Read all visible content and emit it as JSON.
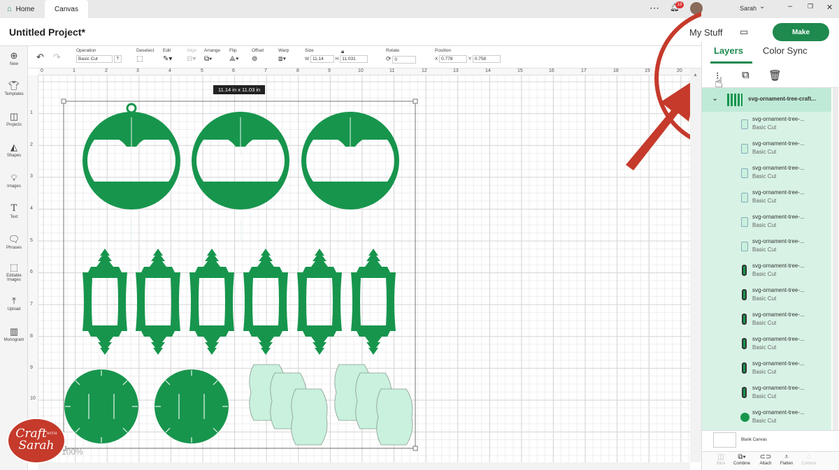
{
  "tabs": {
    "home": "Home",
    "canvas": "Canvas"
  },
  "window": {
    "notifications": "13",
    "user": "Sarah",
    "my_stuff": "My Stuff"
  },
  "header": {
    "project_title": "Untitled Project*",
    "make": "Make"
  },
  "left_nav": [
    "New",
    "Templates",
    "Projects",
    "Shapes",
    "Images",
    "Text",
    "Phrases",
    "Editable Images",
    "Upload",
    "Monogram"
  ],
  "toolbar": {
    "operation_label": "Operation",
    "operation_value": "Basic Cut",
    "deselect": "Deselect",
    "edit": "Edit",
    "align": "Align",
    "arrange": "Arrange",
    "flip": "Flip",
    "offset": "Offset",
    "warp": "Warp",
    "size_label": "Size",
    "w_label": "W",
    "w_value": "11.14",
    "h_label": "H",
    "h_value": "11.031",
    "rotate_label": "Rotate",
    "rotate_value": "0",
    "position_label": "Position",
    "x_label": "X",
    "x_value": "0.778",
    "y_label": "Y",
    "y_value": "0.758"
  },
  "rulers": {
    "top": [
      "0",
      "1",
      "2",
      "3",
      "4",
      "5",
      "6",
      "7",
      "8",
      "9",
      "10",
      "11",
      "12",
      "13",
      "14",
      "15",
      "16",
      "17",
      "18",
      "19",
      "20"
    ],
    "left": [
      "1",
      "2",
      "3",
      "4",
      "5",
      "6",
      "7",
      "8",
      "9",
      "10"
    ]
  },
  "canvas": {
    "size_tooltip": "11.14  in x 11.03  in",
    "zoom": "100%"
  },
  "panel": {
    "tab_layers": "Layers",
    "tab_color": "Color Sync",
    "group_name": "svg-ornament-tree-craft...",
    "layers": [
      {
        "name": "svg-ornament-tree-...",
        "op": "Basic Cut",
        "color": "#c9f1dd",
        "shape": "rect"
      },
      {
        "name": "svg-ornament-tree-...",
        "op": "Basic Cut",
        "color": "#c9f1dd",
        "shape": "rect"
      },
      {
        "name": "svg-ornament-tree-...",
        "op": "Basic Cut",
        "color": "#c9f1dd",
        "shape": "rect"
      },
      {
        "name": "svg-ornament-tree-...",
        "op": "Basic Cut",
        "color": "#c9f1dd",
        "shape": "rect"
      },
      {
        "name": "svg-ornament-tree-...",
        "op": "Basic Cut",
        "color": "#c9f1dd",
        "shape": "rect"
      },
      {
        "name": "svg-ornament-tree-...",
        "op": "Basic Cut",
        "color": "#c9f1dd",
        "shape": "rect"
      },
      {
        "name": "svg-ornament-tree-...",
        "op": "Basic Cut",
        "color": "#17954d",
        "shape": "lantern"
      },
      {
        "name": "svg-ornament-tree-...",
        "op": "Basic Cut",
        "color": "#17954d",
        "shape": "lantern"
      },
      {
        "name": "svg-ornament-tree-...",
        "op": "Basic Cut",
        "color": "#17954d",
        "shape": "lantern"
      },
      {
        "name": "svg-ornament-tree-...",
        "op": "Basic Cut",
        "color": "#17954d",
        "shape": "lantern"
      },
      {
        "name": "svg-ornament-tree-...",
        "op": "Basic Cut",
        "color": "#17954d",
        "shape": "lantern"
      },
      {
        "name": "svg-ornament-tree-...",
        "op": "Basic Cut",
        "color": "#17954d",
        "shape": "lantern"
      },
      {
        "name": "svg-ornament-tree-...",
        "op": "Basic Cut",
        "color": "#17954d",
        "shape": "circle"
      }
    ],
    "blank_canvas": "Blank Canvas",
    "bottom_tools": [
      "Slice",
      "Combine",
      "Attach",
      "Flatten",
      "Contour"
    ]
  },
  "logo": {
    "line1": "Craft",
    "with": "WITH",
    "line2": "Sarah"
  },
  "colors": {
    "brand": "#1e8a4e",
    "ornament": "#17954d",
    "light": "#c9f1dd",
    "annotation": "#c53a2b"
  }
}
